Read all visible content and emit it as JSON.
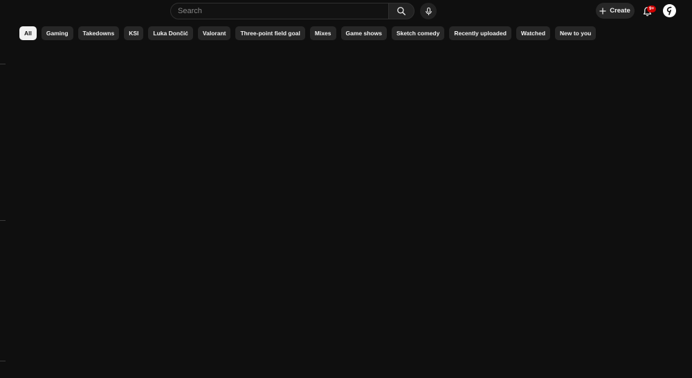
{
  "header": {
    "search": {
      "placeholder": "Search",
      "value": ""
    },
    "create_label": "Create",
    "notifications_badge": "9+"
  },
  "chips": [
    {
      "label": "All",
      "active": true
    },
    {
      "label": "Gaming",
      "active": false
    },
    {
      "label": "Takedowns",
      "active": false
    },
    {
      "label": "KSI",
      "active": false
    },
    {
      "label": "Luka Dončić",
      "active": false
    },
    {
      "label": "Valorant",
      "active": false
    },
    {
      "label": "Three-point field goal",
      "active": false
    },
    {
      "label": "Mixes",
      "active": false
    },
    {
      "label": "Game shows",
      "active": false
    },
    {
      "label": "Sketch comedy",
      "active": false
    },
    {
      "label": "Recently uploaded",
      "active": false
    },
    {
      "label": "Watched",
      "active": false
    },
    {
      "label": "New to you",
      "active": false
    }
  ],
  "colors": {
    "background": "#0f0f0f",
    "chip": "#272727",
    "chip_active": "#f1f1f1",
    "badge": "#cc0000"
  },
  "icons": [
    "search-icon",
    "microphone-icon",
    "plus-icon",
    "bell-icon",
    "avatar-logo-icon"
  ]
}
